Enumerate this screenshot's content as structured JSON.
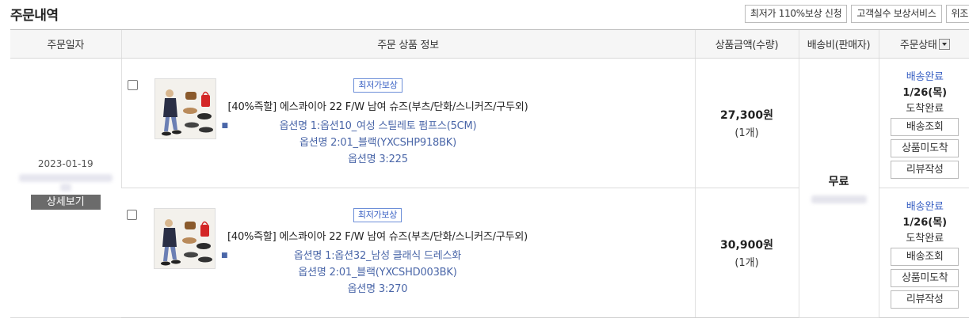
{
  "page_title": "주문내역",
  "top_buttons": [
    "최저가 110%보상 신청",
    "고객실수 보상서비스",
    "위조"
  ],
  "table": {
    "headers": {
      "date": "주문일자",
      "product": "주문 상품 정보",
      "price": "상품금액(수량)",
      "shipping": "배송비(판매자)",
      "status": "주문상태"
    }
  },
  "order": {
    "date": "2023-01-19",
    "detail_label": "상세보기",
    "shipping_label": "무료",
    "items": [
      {
        "badge": "최저가보상",
        "name": "[40%즉할] 에스콰이아 22 F/W 남여 슈즈(부츠/단화/스니커즈/구두외)",
        "options": [
          "옵션명 1:옵션10_여성 스틸레토 펌프스(5CM)",
          "옵션명 2:01_블랙(YXCSHP918BK)",
          "옵션명 3:225"
        ],
        "price": "27,300원",
        "qty": "(1개)",
        "status": "배송완료",
        "status_date": "1/26(목)",
        "status_note": "도착완료",
        "actions": [
          "배송조회",
          "상품미도착",
          "리뷰작성"
        ]
      },
      {
        "badge": "최저가보상",
        "name": "[40%즉할] 에스콰이아 22 F/W 남여 슈즈(부츠/단화/스니커즈/구두외)",
        "options": [
          "옵션명 1:옵션32_남성 클래식 드레스화",
          "옵션명 2:01_블랙(YXCSHD003BK)",
          "옵션명 3:270"
        ],
        "price": "30,900원",
        "qty": "(1개)",
        "status": "배송완료",
        "status_date": "1/26(목)",
        "status_note": "도착완료",
        "actions": [
          "배송조회",
          "상품미도착",
          "리뷰작성"
        ]
      }
    ]
  },
  "colors": {
    "accent_blue": "#3b62c4",
    "option_blue": "#4a66a8",
    "header_bg": "#f6f6f6"
  }
}
